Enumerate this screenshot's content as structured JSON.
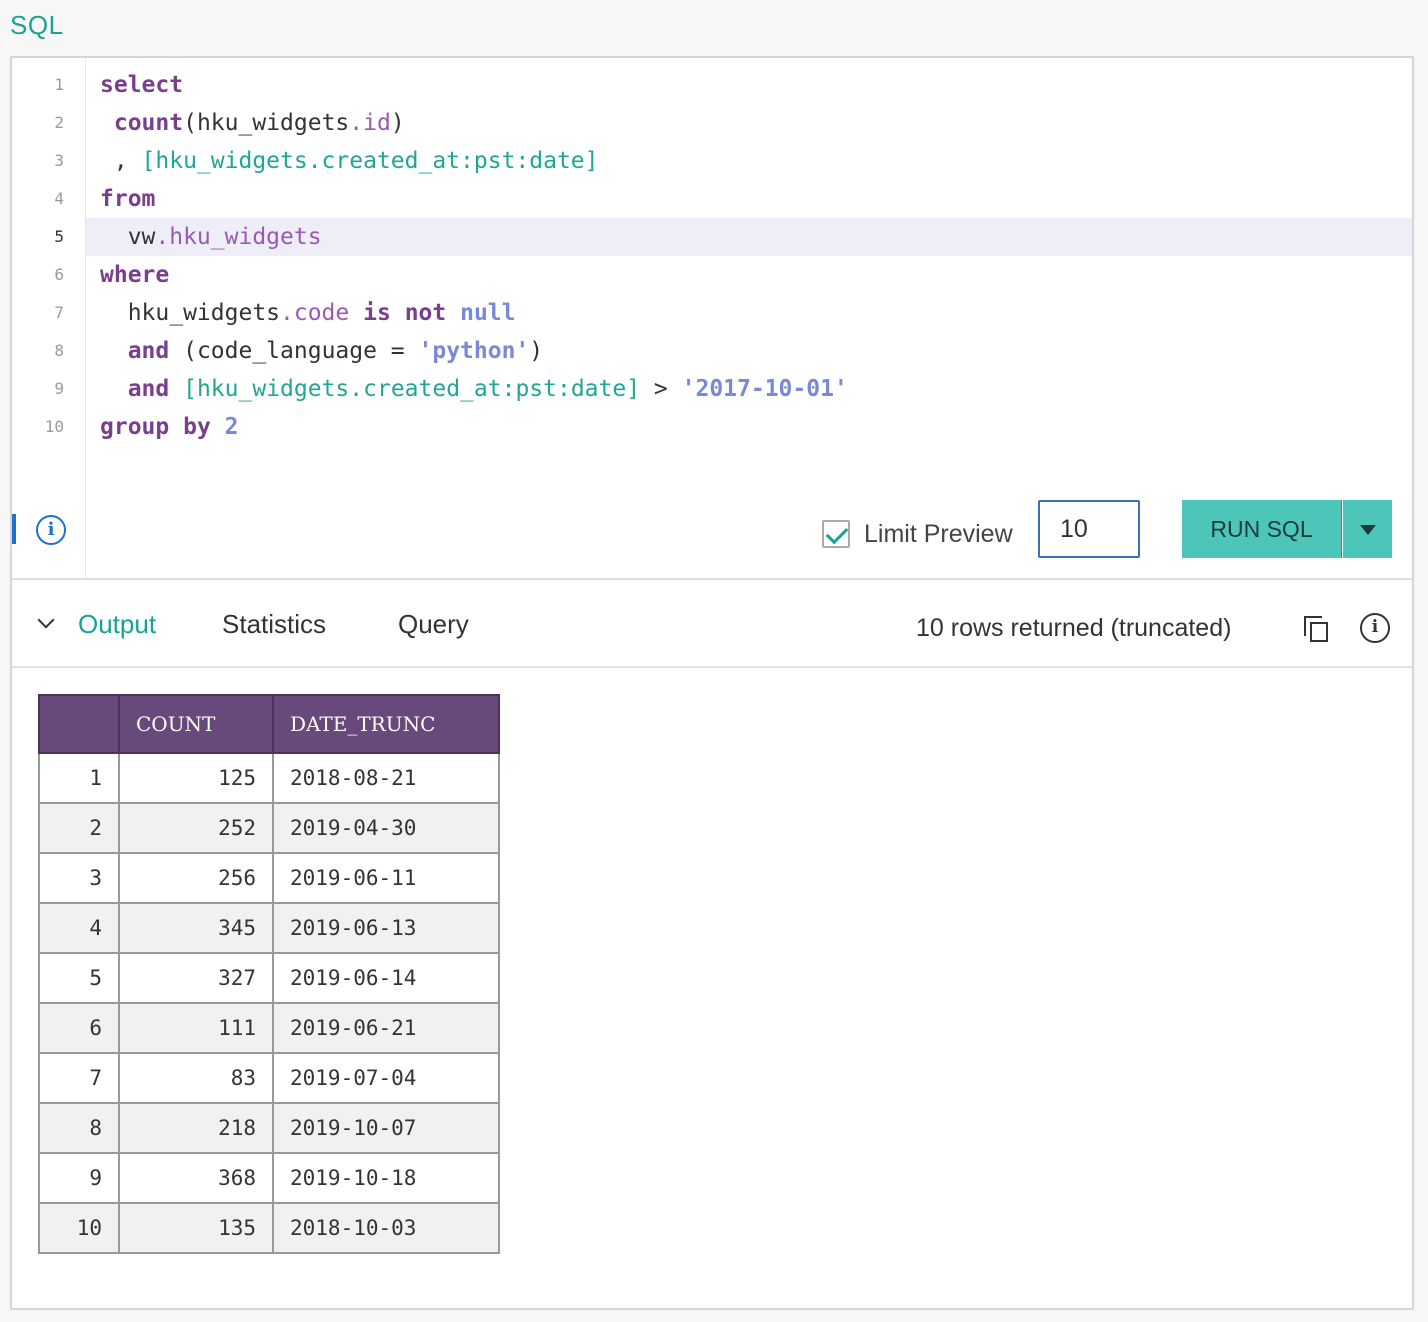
{
  "section_label": "SQL",
  "editor": {
    "line_numbers": [
      "1",
      "2",
      "3",
      "4",
      "5",
      "6",
      "7",
      "8",
      "9",
      "10"
    ],
    "active_line": "5",
    "lines": [
      [
        {
          "t": "select",
          "c": "kw"
        }
      ],
      [
        {
          "t": " "
        },
        {
          "t": "count",
          "c": "kw"
        },
        {
          "t": "(hku_widgets"
        },
        {
          "t": ".id",
          "c": "at"
        },
        {
          "t": ")"
        }
      ],
      [
        {
          "t": " , "
        },
        {
          "t": "[hku_widgets.created_at:pst:date]",
          "c": "tp"
        }
      ],
      [
        {
          "t": "from",
          "c": "kw"
        }
      ],
      [
        {
          "t": "  vw"
        },
        {
          "t": ".hku_widgets",
          "c": "at"
        }
      ],
      [
        {
          "t": "where",
          "c": "kw"
        }
      ],
      [
        {
          "t": "  hku_widgets"
        },
        {
          "t": ".code",
          "c": "at"
        },
        {
          "t": " "
        },
        {
          "t": "is",
          "c": "kw"
        },
        {
          "t": " "
        },
        {
          "t": "not",
          "c": "kw"
        },
        {
          "t": " "
        },
        {
          "t": "null",
          "c": "kw2"
        }
      ],
      [
        {
          "t": "  "
        },
        {
          "t": "and",
          "c": "kw"
        },
        {
          "t": " (code_language = "
        },
        {
          "t": "'python'",
          "c": "str"
        },
        {
          "t": ")"
        }
      ],
      [
        {
          "t": "  "
        },
        {
          "t": "and",
          "c": "kw"
        },
        {
          "t": " "
        },
        {
          "t": "[hku_widgets.created_at:pst:date]",
          "c": "tp"
        },
        {
          "t": " > "
        },
        {
          "t": "'2017-10-01'",
          "c": "str"
        }
      ],
      [
        {
          "t": "group",
          "c": "kw"
        },
        {
          "t": " "
        },
        {
          "t": "by",
          "c": "kw"
        },
        {
          "t": " "
        },
        {
          "t": "2",
          "c": "num"
        }
      ]
    ]
  },
  "controls": {
    "limit_label": "Limit Preview",
    "limit_checked": true,
    "limit_value": "10",
    "run_label": "RUN SQL",
    "info_glyph": "i",
    "dropdown_icon": "caret-down-icon"
  },
  "output": {
    "tabs": [
      "Output",
      "Statistics",
      "Query"
    ],
    "active_tab": "Output",
    "rows_message": "10 rows returned (truncated)",
    "columns": [
      "",
      "COUNT",
      "DATE_TRUNC"
    ],
    "rows": [
      [
        "1",
        "125",
        "2018-08-21"
      ],
      [
        "2",
        "252",
        "2019-04-30"
      ],
      [
        "3",
        "256",
        "2019-06-11"
      ],
      [
        "4",
        "345",
        "2019-06-13"
      ],
      [
        "5",
        "327",
        "2019-06-14"
      ],
      [
        "6",
        "111",
        "2019-06-21"
      ],
      [
        "7",
        "83",
        "2019-07-04"
      ],
      [
        "8",
        "218",
        "2019-10-07"
      ],
      [
        "9",
        "368",
        "2019-10-18"
      ],
      [
        "10",
        "135",
        "2018-10-03"
      ]
    ]
  },
  "colors": {
    "accent": "#1aa394",
    "button": "#4cc6b8",
    "table_header": "#674a7b",
    "keyword": "#7a3e8f"
  }
}
